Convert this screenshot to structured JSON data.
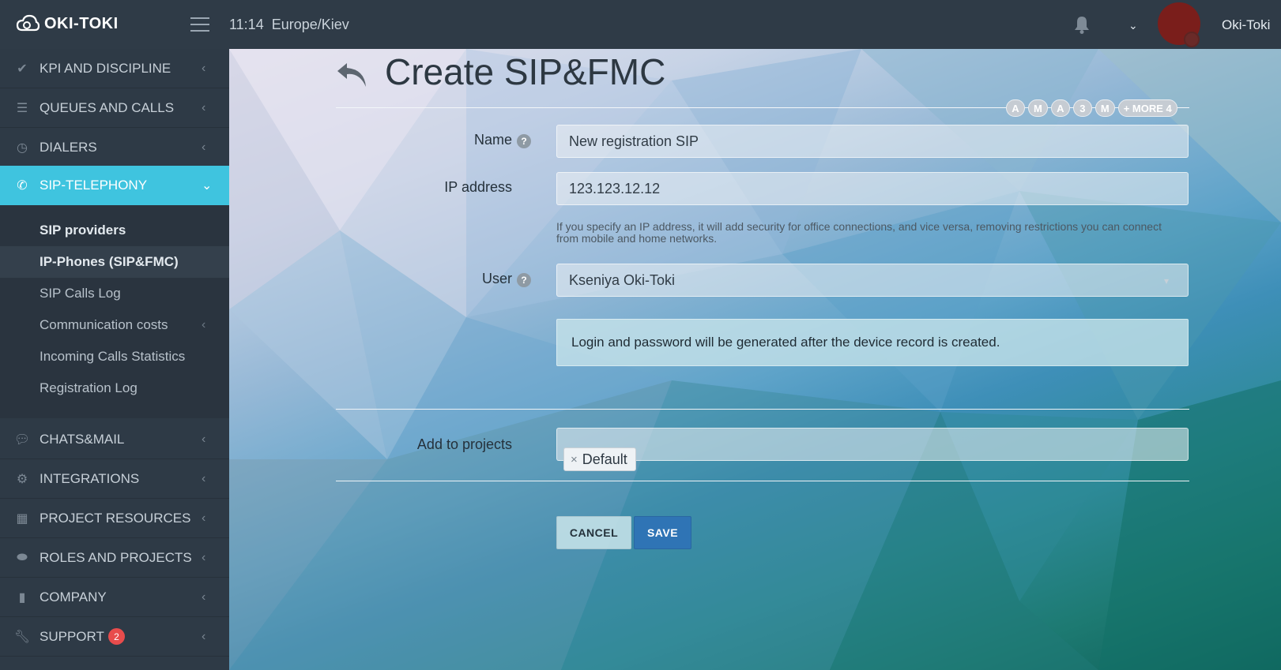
{
  "topbar": {
    "brand": "OKI-TOKI",
    "time": "11:14",
    "timezone": "Europe/Kiev",
    "username": "Oki-Toki"
  },
  "sidebar": {
    "items_top": [
      {
        "label": "KPI AND DISCIPLINE",
        "icon": "check-icon"
      },
      {
        "label": "QUEUES AND CALLS",
        "icon": "list-icon"
      },
      {
        "label": "DIALERS",
        "icon": "clock-icon"
      },
      {
        "label": "SIP-TELEPHONY",
        "icon": "phone-icon"
      }
    ],
    "sub_items": [
      {
        "label": "SIP providers"
      },
      {
        "label": "IP-Phones (SIP&FMC)"
      },
      {
        "label": "SIP Calls Log"
      },
      {
        "label": "Communication costs"
      },
      {
        "label": "Incoming Calls Statistics"
      },
      {
        "label": "Registration Log"
      }
    ],
    "items_bottom": [
      {
        "label": "CHATS&MAIL",
        "icon": "chat-icon"
      },
      {
        "label": "INTEGRATIONS",
        "icon": "gears-icon"
      },
      {
        "label": "PROJECT RESOURCES",
        "icon": "grid-icon"
      },
      {
        "label": "ROLES AND PROJECTS",
        "icon": "toggle-icon"
      },
      {
        "label": "COMPANY",
        "icon": "bar-chart-icon"
      },
      {
        "label": "SUPPORT",
        "icon": "wrench-icon",
        "badge": "2"
      }
    ]
  },
  "page": {
    "title": "Create SIP&FMC",
    "pills": [
      "A",
      "M",
      "A",
      "3",
      "M",
      "+ MORE 4"
    ]
  },
  "form": {
    "name_label": "Name",
    "name_value": "New registration SIP",
    "ip_label": "IP address",
    "ip_value": "123.123.12.12",
    "ip_hint": "If you specify an IP address, it will add security for office connections, and vice versa, removing restrictions you can connect from mobile and home networks.",
    "user_label": "User",
    "user_value": "Kseniya Oki-Toki",
    "info_text": "Login and password will be generated after the device record is created.",
    "projects_label": "Add to projects",
    "project_tag": "Default",
    "cancel_label": "CANCEL",
    "save_label": "SAVE"
  },
  "colors": {
    "accent": "#3fc4df",
    "save": "#2f74b5",
    "badge": "#e84c4c",
    "sidebar_bg": "#2e3a46"
  }
}
